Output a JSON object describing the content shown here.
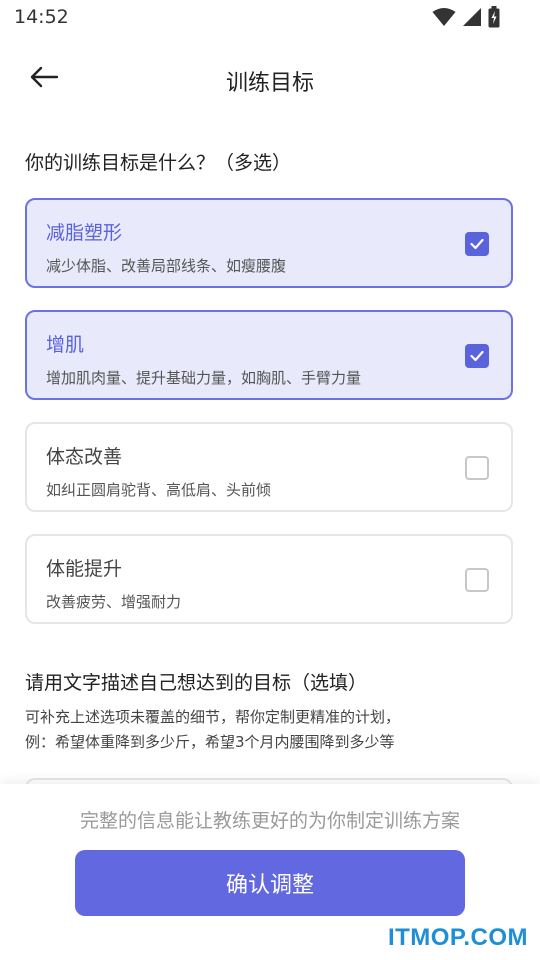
{
  "status_bar": {
    "time": "14:52",
    "icons": [
      "wifi-icon",
      "signal-icon",
      "battery-charging-icon"
    ]
  },
  "header": {
    "title": "训练目标",
    "back_icon": "arrow-left-icon"
  },
  "goal_question": "你的训练目标是什么？（多选）",
  "options": [
    {
      "title": "减脂塑形",
      "desc": "减少体脂、改善局部线条、如瘦腰腹",
      "selected": true
    },
    {
      "title": "增肌",
      "desc": "增加肌肉量、提升基础力量，如胸肌、手臂力量",
      "selected": true
    },
    {
      "title": "体态改善",
      "desc": "如纠正圆肩驼背、高低肩、头前倾",
      "selected": false
    },
    {
      "title": "体能提升",
      "desc": "改善疲劳、增强耐力",
      "selected": false
    }
  ],
  "describe_section": {
    "title": "请用文字描述自己想达到的目标（选填）",
    "hint_line1": "可补充上述选项未覆盖的细节，帮你定制更精准的计划，",
    "hint_line2": "例：希望体重降到多少斤，希望3个月内腰围降到多少等"
  },
  "footer": {
    "note": "完整的信息能让教练更好的为你制定训练方案",
    "confirm_label": "确认调整"
  },
  "watermark": "ITMOP.COM",
  "colors": {
    "accent": "#6268e0",
    "selected_bg": "#e8eafc",
    "selected_border": "#6b72e4",
    "watermark": "#1e8fd4"
  }
}
